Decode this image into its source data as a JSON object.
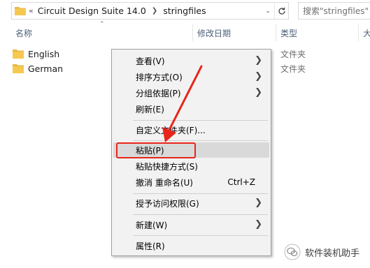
{
  "address_bar": {
    "overflow_chevrons": "«",
    "crumbs": [
      "Circuit Design Suite 14.0",
      "stringfiles"
    ],
    "search_placeholder": "搜索\"stringfiles\""
  },
  "columns": {
    "name": "名称",
    "date_modified": "修改日期",
    "type": "类型",
    "size_clipped": "大"
  },
  "files": [
    {
      "name": "English",
      "type": "文件夹"
    },
    {
      "name": "German",
      "type": "文件夹"
    }
  ],
  "context_menu": {
    "items": [
      {
        "label": "查看(V)",
        "submenu": true
      },
      {
        "label": "排序方式(O)",
        "submenu": true
      },
      {
        "label": "分组依据(P)",
        "submenu": true
      },
      {
        "label": "刷新(E)"
      },
      {
        "label": "自定义文件夹(F)..."
      },
      {
        "label": "粘贴(P)",
        "highlighted": true
      },
      {
        "label": "粘贴快捷方式(S)"
      },
      {
        "label": "撤消 重命名(U)",
        "shortcut": "Ctrl+Z"
      },
      {
        "label": "授予访问权限(G)",
        "submenu": true
      },
      {
        "label": "新建(W)",
        "submenu": true
      },
      {
        "label": "属性(R)"
      }
    ]
  },
  "watermark": {
    "text": "软件装机助手"
  },
  "colors": {
    "folder": "#f5c94f",
    "menu_bg": "#f2f2f2",
    "highlight": "#d9d9d9",
    "annotation_red": "#e8251a",
    "header_text": "#4c607a"
  }
}
